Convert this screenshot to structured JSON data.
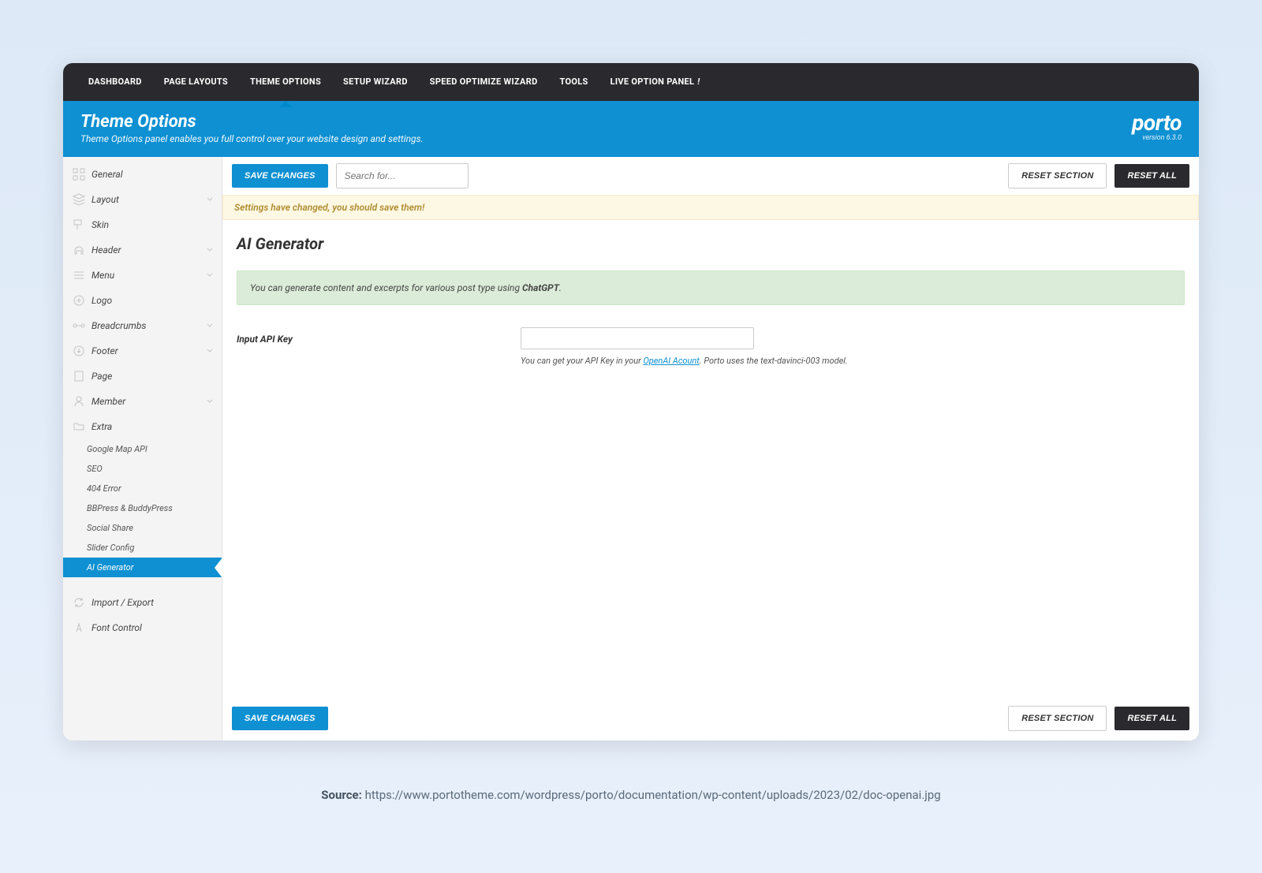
{
  "topnav": {
    "items": [
      {
        "label": "DASHBOARD"
      },
      {
        "label": "PAGE LAYOUTS"
      },
      {
        "label": "THEME OPTIONS"
      },
      {
        "label": "SETUP WIZARD"
      },
      {
        "label": "SPEED OPTIMIZE WIZARD"
      },
      {
        "label": "TOOLS"
      },
      {
        "label": "LIVE OPTION PANEL",
        "suffix": "!"
      }
    ],
    "active_index": 2
  },
  "bluebar": {
    "title": "Theme Options",
    "subtitle": "Theme Options panel enables you full control over your website design and settings."
  },
  "brand": {
    "name": "porto",
    "version": "version 6.3.0"
  },
  "toolbar": {
    "save": "SAVE CHANGES",
    "search_placeholder": "Search for...",
    "reset_section": "RESET SECTION",
    "reset_all": "RESET ALL"
  },
  "warning": "Settings have changed, you should save them!",
  "page": {
    "title": "AI Generator",
    "info_prefix": "You can generate content and excerpts for various post type using ",
    "info_strong": "ChatGPT",
    "info_suffix": ".",
    "field_label": "Input API Key",
    "api_key_value": "",
    "help_prefix": "You can get your API Key in your ",
    "help_link": "OpenAI Acount",
    "help_suffix": ". Porto uses the text-davinci-003 model."
  },
  "sidebar": {
    "items": [
      {
        "label": "General",
        "icon": "grid-icon",
        "expandable": false
      },
      {
        "label": "Layout",
        "icon": "layers-icon",
        "expandable": true
      },
      {
        "label": "Skin",
        "icon": "paint-icon",
        "expandable": false
      },
      {
        "label": "Header",
        "icon": "headset-icon",
        "expandable": true
      },
      {
        "label": "Menu",
        "icon": "lines-icon",
        "expandable": true
      },
      {
        "label": "Logo",
        "icon": "circle-plus-icon",
        "expandable": false
      },
      {
        "label": "Breadcrumbs",
        "icon": "breadcrumb-icon",
        "expandable": true
      },
      {
        "label": "Footer",
        "icon": "download-icon",
        "expandable": true
      },
      {
        "label": "Page",
        "icon": "page-icon",
        "expandable": false
      },
      {
        "label": "Member",
        "icon": "user-icon",
        "expandable": true
      },
      {
        "label": "Extra",
        "icon": "folder-icon",
        "expandable": false
      }
    ],
    "extra_subitems": [
      {
        "label": "Google Map API"
      },
      {
        "label": "SEO"
      },
      {
        "label": "404 Error"
      },
      {
        "label": "BBPress & BuddyPress"
      },
      {
        "label": "Social Share"
      },
      {
        "label": "Slider Config"
      },
      {
        "label": "AI Generator"
      }
    ],
    "active_sub_index": 6,
    "bottom_items": [
      {
        "label": "Import / Export",
        "icon": "refresh-icon"
      },
      {
        "label": "Font Control",
        "icon": "font-icon"
      }
    ]
  },
  "footer_toolbar": {
    "save": "SAVE CHANGES",
    "reset_section": "RESET SECTION",
    "reset_all": "RESET ALL"
  },
  "source": {
    "label": "Source:",
    "url": "https://www.portotheme.com/wordpress/porto/documentation/wp-content/uploads/2023/02/doc-openai.jpg"
  }
}
